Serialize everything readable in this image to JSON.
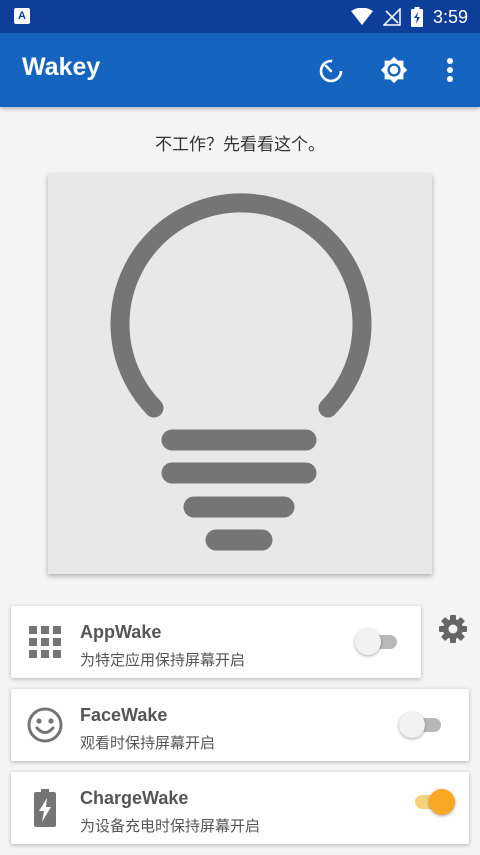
{
  "status_bar": {
    "notification_icon": "a-icon",
    "time": "3:59",
    "icons": [
      "wifi-icon",
      "signal-off-icon",
      "battery-charging-icon"
    ]
  },
  "app_bar": {
    "title": "Wakey",
    "actions": [
      "timer-icon",
      "brightness-icon",
      "more-vert-icon"
    ],
    "background": "#1565c0"
  },
  "hint": "不工作？先看看这个。",
  "main": {
    "illustration": "lightbulb-icon"
  },
  "features": [
    {
      "icon": "apps-grid-icon",
      "title": "AppWake",
      "subtitle": "为特定应用保持屏幕开启",
      "enabled": false
    },
    {
      "icon": "face-icon",
      "title": "FaceWake",
      "subtitle": "观看时保持屏幕开启",
      "enabled": false
    },
    {
      "icon": "battery-charging-icon",
      "title": "ChargeWake",
      "subtitle": "为设备充电时保持屏幕开启",
      "enabled": true
    }
  ],
  "appwake_settings_icon": "gear-icon",
  "colors": {
    "status_bar": "#0d3f9a",
    "toggle_on": "#f9a825",
    "icon_gray": "#757575"
  }
}
